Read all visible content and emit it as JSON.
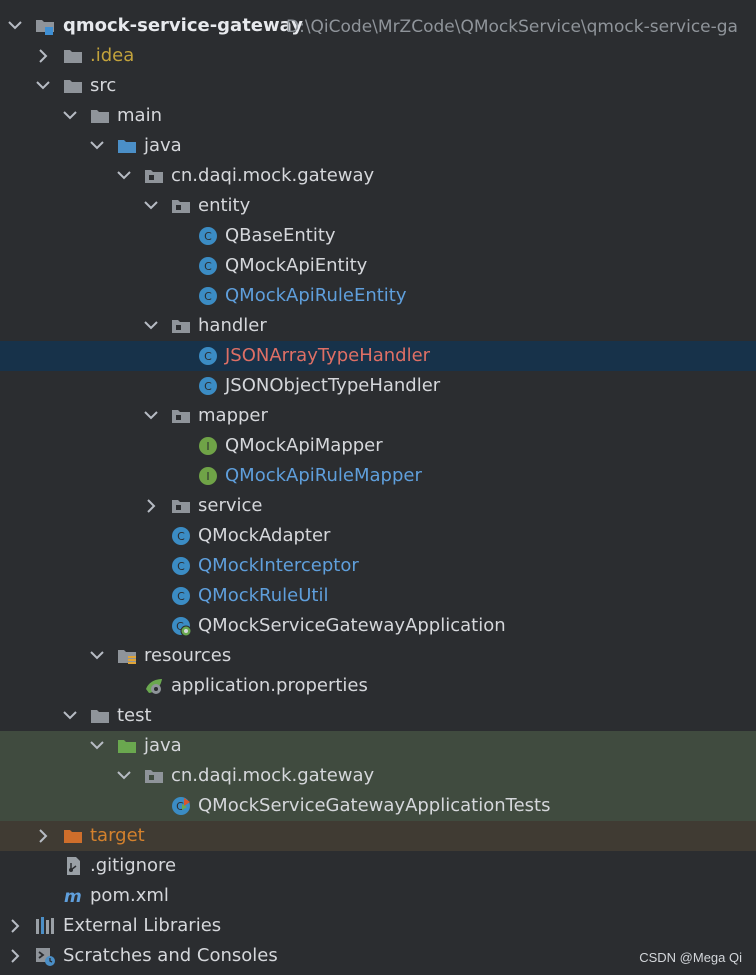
{
  "project_tree": {
    "root": {
      "label": "qmock-service-gateway",
      "path": "D:\\QiCode\\MrZCode\\QMockService\\qmock-service-ga"
    },
    "items": [
      {
        "id": "idea",
        "label": ".idea",
        "color": "#c3a33c",
        "icon_name": "folder-icon"
      },
      {
        "id": "src",
        "label": "src",
        "color": "#d5d7db",
        "icon_name": "folder-icon"
      },
      {
        "id": "main",
        "label": "main",
        "color": "#d5d7db",
        "icon_name": "folder-icon"
      },
      {
        "id": "java_main",
        "label": "java",
        "color": "#d5d7db",
        "icon_name": "source-folder-icon"
      },
      {
        "id": "pkg_main",
        "label": "cn.daqi.mock.gateway",
        "color": "#d5d7db",
        "icon_name": "package-icon"
      },
      {
        "id": "entity",
        "label": "entity",
        "color": "#d5d7db",
        "icon_name": "package-icon"
      },
      {
        "id": "qbaseentity",
        "label": "QBaseEntity",
        "color": "#d5d7db",
        "icon_name": "class-icon"
      },
      {
        "id": "qmockapientity",
        "label": "QMockApiEntity",
        "color": "#d5d7db",
        "icon_name": "class-icon"
      },
      {
        "id": "qmockapiruleentity",
        "label": "QMockApiRuleEntity",
        "color": "#5f9fdc",
        "icon_name": "class-icon"
      },
      {
        "id": "handler",
        "label": "handler",
        "color": "#d5d7db",
        "icon_name": "package-icon"
      },
      {
        "id": "jsonarraytypehandler",
        "label": "JSONArrayTypeHandler",
        "color": "#de6f65",
        "icon_name": "class-icon"
      },
      {
        "id": "jsonobjecttypehandler",
        "label": "JSONObjectTypeHandler",
        "color": "#d5d7db",
        "icon_name": "class-icon"
      },
      {
        "id": "mapper",
        "label": "mapper",
        "color": "#d5d7db",
        "icon_name": "package-icon"
      },
      {
        "id": "qmockapimapper",
        "label": "QMockApiMapper",
        "color": "#d5d7db",
        "icon_name": "interface-icon"
      },
      {
        "id": "qmockapirulemapper",
        "label": "QMockApiRuleMapper",
        "color": "#5f9fdc",
        "icon_name": "interface-icon"
      },
      {
        "id": "service",
        "label": "service",
        "color": "#d5d7db",
        "icon_name": "package-icon"
      },
      {
        "id": "qmockadapter",
        "label": "QMockAdapter",
        "color": "#d5d7db",
        "icon_name": "class-icon"
      },
      {
        "id": "qmockinterceptor",
        "label": "QMockInterceptor",
        "color": "#5f9fdc",
        "icon_name": "class-icon"
      },
      {
        "id": "qmockruleutil",
        "label": "QMockRuleUtil",
        "color": "#5f9fdc",
        "icon_name": "class-icon"
      },
      {
        "id": "qmockservicegatewayapplication",
        "label": "QMockServiceGatewayApplication",
        "color": "#d5d7db",
        "icon_name": "spring-class-icon"
      },
      {
        "id": "resources",
        "label": "resources",
        "color": "#d5d7db",
        "icon_name": "resources-folder-icon"
      },
      {
        "id": "application_properties",
        "label": "application.properties",
        "color": "#d5d7db",
        "icon_name": "spring-properties-icon"
      },
      {
        "id": "test",
        "label": "test",
        "color": "#d5d7db",
        "icon_name": "folder-icon"
      },
      {
        "id": "java_test",
        "label": "java",
        "color": "#d5d7db",
        "icon_name": "test-source-folder-icon"
      },
      {
        "id": "pkg_test",
        "label": "cn.daqi.mock.gateway",
        "color": "#d5d7db",
        "icon_name": "package-icon"
      },
      {
        "id": "qmockservicegatewayapplicationtests",
        "label": "QMockServiceGatewayApplicationTests",
        "color": "#d5d7db",
        "icon_name": "test-class-icon"
      },
      {
        "id": "target",
        "label": "target",
        "color": "#d4812d",
        "icon_name": "excluded-folder-icon"
      },
      {
        "id": "gitignore",
        "label": ".gitignore",
        "color": "#d5d7db",
        "icon_name": "gitignore-file-icon"
      },
      {
        "id": "pom_xml",
        "label": "pom.xml",
        "color": "#d5d7db",
        "icon_name": "maven-file-icon"
      },
      {
        "id": "external_libraries",
        "label": "External Libraries",
        "color": "#d5d7db",
        "icon_name": "libraries-icon"
      },
      {
        "id": "scratches_consoles",
        "label": "Scratches and Consoles",
        "color": "#d5d7db",
        "icon_name": "scratches-icon"
      }
    ]
  },
  "watermark": "CSDN @Mega Qi",
  "colors": {
    "panel_bg": "#2b2d30",
    "selection_bg": "#17324a",
    "test_bg": "#404b3f",
    "target_bg": "#403b33",
    "folder_gray": "#8f949a",
    "folder_blue": "#4b8fc7",
    "folder_green": "#6aa84f",
    "folder_orange": "#cf6e2b",
    "class_blue": "#3b8cc4",
    "interface_green": "#6fa347"
  }
}
